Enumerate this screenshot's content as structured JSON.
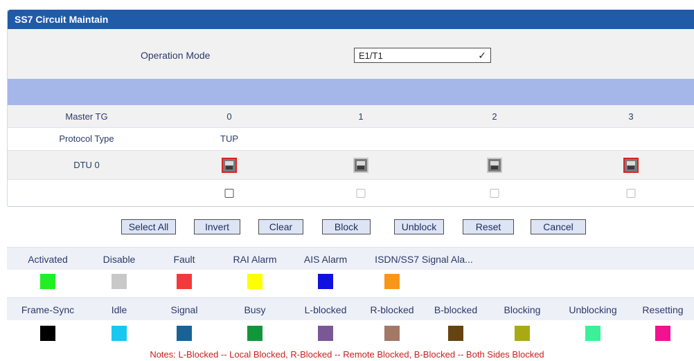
{
  "panel": {
    "title": "SS7 Circuit Maintain"
  },
  "operation_mode": {
    "label": "Operation Mode",
    "selected": "E1/T1"
  },
  "table": {
    "master_tg_label": "Master TG",
    "master_tg_values": [
      "0",
      "1",
      "2",
      "3"
    ],
    "protocol_label": "Protocol Type",
    "protocol_value": "TUP",
    "dtu_label": "DTU 0",
    "port_states": [
      "red",
      "gray",
      "gray",
      "red"
    ],
    "checkbox_enabled": [
      true,
      false,
      false,
      false
    ]
  },
  "buttons": {
    "select_all": "Select All",
    "invert": "Invert",
    "clear": "Clear",
    "block": "Block",
    "unblock": "Unblock",
    "reset": "Reset",
    "cancel": "Cancel"
  },
  "legend_top": [
    {
      "label": "Activated",
      "color": "#22ee22"
    },
    {
      "label": "Disable",
      "color": "#c8c8c8"
    },
    {
      "label": "Fault",
      "color": "#f23a3a"
    },
    {
      "label": "RAI Alarm",
      "color": "#ffff00"
    },
    {
      "label": "AIS Alarm",
      "color": "#1010e0"
    },
    {
      "label": "ISDN/SS7 Signal Ala...",
      "color": "#f8961a"
    }
  ],
  "legend_bottom": [
    {
      "label": "Frame-Sync",
      "color": "#000000"
    },
    {
      "label": "Idle",
      "color": "#18c8f0"
    },
    {
      "label": "Signal",
      "color": "#1a6296"
    },
    {
      "label": "Busy",
      "color": "#12963c"
    },
    {
      "label": "L-blocked",
      "color": "#7a5896"
    },
    {
      "label": "R-blocked",
      "color": "#a27866"
    },
    {
      "label": "B-blocked",
      "color": "#664412"
    },
    {
      "label": "Blocking",
      "color": "#a8aa14"
    },
    {
      "label": "Unblocking",
      "color": "#3cf09a"
    },
    {
      "label": "Resetting",
      "color": "#f0128e"
    }
  ],
  "notes": "Notes: L-Blocked -- Local Blocked, R-Blocked -- Remote Blocked, B-Blocked -- Both Sides Blocked"
}
